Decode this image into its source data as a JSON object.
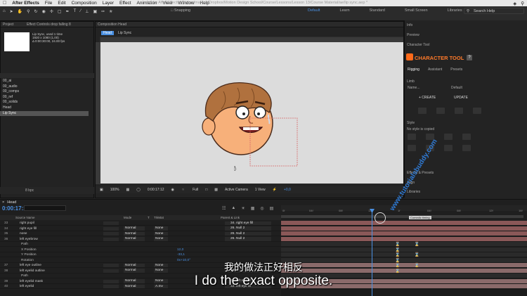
{
  "menubar": {
    "app": "After Effects",
    "items": [
      "File",
      "Edit",
      "Composition",
      "Layer",
      "Effect",
      "Animation",
      "View",
      "Window",
      "Help"
    ]
  },
  "toolbar": {
    "title": "Adobe After Effects - /Users/markus/Dropbox/Motion Design School/Course/Lessons/Lesson 13/Course Material/ae/lip sync.aep *",
    "snapping": "Snapping",
    "workspaces": [
      "Default",
      "Learn",
      "Standard",
      "Small Screen",
      "Libraries"
    ],
    "search": "Search Help"
  },
  "project": {
    "tab": "Project",
    "effects_tab": "Effect Controls drop falling 8",
    "comp_name": "Lip Sync",
    "comp_used": ", used 1 time",
    "comp_info": [
      "1920 x 1080 (1,00)",
      "Δ 0:00:30:00, 24.00 fps"
    ],
    "items": [
      "00_ai",
      "00_audio",
      "00_comps",
      "00_ref",
      "00_solids",
      "Head",
      "Lip Sync"
    ],
    "bpc": "8 bpc"
  },
  "composition": {
    "tab": "Composition Head",
    "breadcrumbs": [
      "Head",
      "Lip Sync"
    ],
    "zoom": "100%",
    "time": "0:00:17:12",
    "resolution": "Full",
    "camera": "Active Camera",
    "view": "1 View",
    "exposure": "+0,0"
  },
  "right_panel": {
    "items": [
      "Info",
      "Preview",
      "Character Tool"
    ],
    "ct_title": "CHARACTER TOOL",
    "ct_help": "?",
    "ct_tabs": [
      "Rigging",
      "Assistant",
      "Presets"
    ],
    "limb_label": "Limb",
    "limb_name": "Name...",
    "limb_preset": "Default",
    "create": "+ CREATE",
    "update": "UPDATE",
    "style_label": "Style",
    "style_status": "No style is copied",
    "bottom_items": [
      "Effects & Presets",
      "Align",
      "Libraries"
    ]
  },
  "timeline": {
    "tab": "Head",
    "time": "0:00:17:12",
    "col_headers": {
      "source": "Source Name",
      "mode": "Mode",
      "t": "T",
      "trkmat": "TrkMat",
      "parent": "Parent & Link"
    },
    "ruler_ticks": [
      "0f",
      "04f",
      "08f",
      "12f",
      "16f",
      "20f",
      "1f",
      "04f",
      "08f",
      "12f",
      "16f",
      "20f"
    ],
    "marker": "Comedic timing",
    "layers": [
      {
        "num": "33",
        "name": "right pupil",
        "mode": "",
        "trk": "",
        "parent": "34. right eye fill"
      },
      {
        "num": "34",
        "name": "right eye fill",
        "mode": "Normal",
        "trk": "None",
        "parent": "26. Null 2"
      },
      {
        "num": "35",
        "name": "nose",
        "mode": "Normal",
        "trk": "None",
        "parent": "26. Null 2"
      },
      {
        "num": "36",
        "name": "left eyebrow",
        "mode": "Normal",
        "trk": "None",
        "parent": "26. Null 2"
      },
      {
        "num": "",
        "name": "Path",
        "prop": true
      },
      {
        "num": "",
        "name": "X Position",
        "prop": true,
        "val": "12,0"
      },
      {
        "num": "",
        "name": "Y Position",
        "prop": true,
        "val": "-33,1"
      },
      {
        "num": "",
        "name": "Rotation",
        "prop": true,
        "val": "0x+10,0°"
      },
      {
        "num": "37",
        "name": "left eye outline",
        "mode": "Normal",
        "trk": "None",
        "parent": "None"
      },
      {
        "num": "38",
        "name": "left eyelid outline",
        "mode": "Normal",
        "trk": "None",
        "parent": "None"
      },
      {
        "num": "",
        "name": "Path",
        "prop": true
      },
      {
        "num": "39",
        "name": "left eyelid mask",
        "mode": "Normal",
        "trk": "None",
        "parent": "41. left eye fill"
      },
      {
        "num": "40",
        "name": "left eyelid",
        "mode": "Normal",
        "trk": "A.Inv",
        "parent": "42. left eye fill"
      }
    ]
  },
  "subtitles": {
    "cn": "我的做法正好相反",
    "en": "I do the exact opposite."
  },
  "watermark": "www.tutorialsbuddy.com",
  "colors": {
    "accent": "#4a90e2",
    "ct_orange": "#ff7a2a",
    "skin": "#f7b07a",
    "hair": "#b0713e"
  }
}
